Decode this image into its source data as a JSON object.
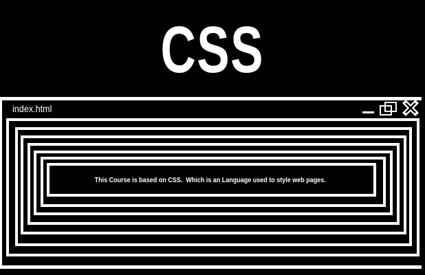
{
  "header": {
    "logo_text": "CSS"
  },
  "window": {
    "title": "index.html",
    "controls": {
      "minimize": "minimize-icon",
      "restore": "restore-icon",
      "close": "close-icon"
    },
    "message": "This Course is based on CSS.  Which is an Language used to style web pages."
  },
  "colors": {
    "background": "#000000",
    "foreground": "#ffffff"
  }
}
